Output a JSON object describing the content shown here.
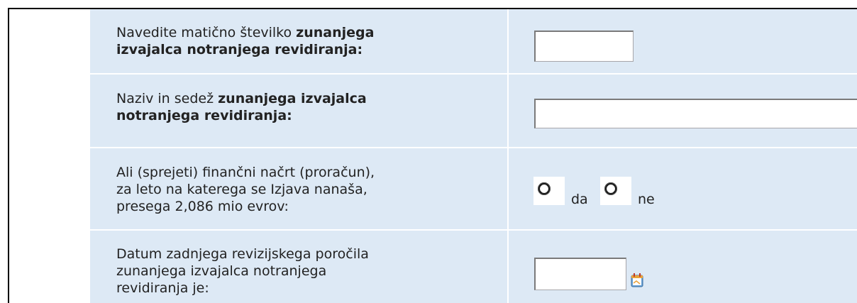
{
  "rows": [
    {
      "label_normal": "Navedite matično številko ",
      "label_bold_1": "zunanjega",
      "label_bold_2": "izvajalca notranjega revidiranja:",
      "input_value": ""
    },
    {
      "label_normal": "Naziv in sedež ",
      "label_bold_1": "zunanjega izvajalca",
      "label_bold_2": "notranjega revidiranja:",
      "input_value": ""
    },
    {
      "line_1": "Ali (sprejeti) finančni načrt (proračun),",
      "line_2": "za leto na katerega se Izjava nanaša,",
      "line_3": "presega 2,086 mio evrov:",
      "option_yes": "da",
      "option_no": "ne",
      "selected": null
    },
    {
      "line_1": "Datum zadnjega revizijskega poročila",
      "line_2": "zunanjega izvajalca notranjega",
      "line_3": "revidiranja je:",
      "input_value": "",
      "icon": "calendar-icon"
    }
  ],
  "colors": {
    "row_background": "#dde9f5",
    "separator": "#ffffff",
    "text": "#222222"
  }
}
